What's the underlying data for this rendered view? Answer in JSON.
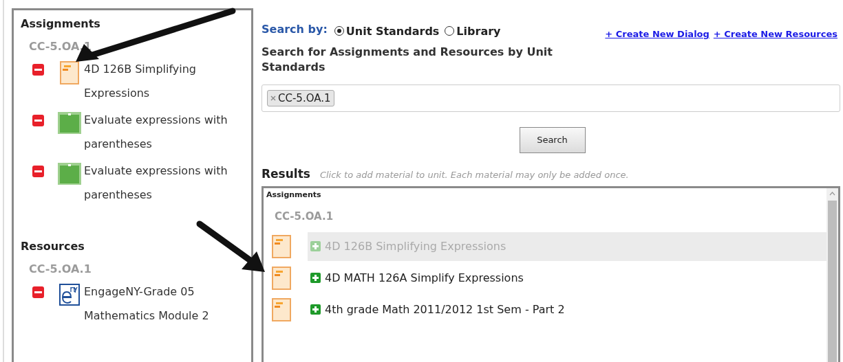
{
  "unit_panel": {
    "sections": [
      {
        "title": "Assignments",
        "standard": "CC-5.OA.1",
        "items": [
          {
            "kind": "document",
            "title": "4D 126B Simplifying Expressions"
          },
          {
            "kind": "lesson",
            "title": "Evaluate expressions with parentheses"
          },
          {
            "kind": "lesson",
            "title": "Evaluate expressions with parentheses"
          }
        ]
      },
      {
        "title": "Resources",
        "standard": "CC-5.OA.1",
        "items": [
          {
            "kind": "engageny",
            "title": "EngageNY-Grade 05 Mathematics Module 2"
          }
        ]
      }
    ]
  },
  "search_by": {
    "label": "Search by:",
    "options": [
      {
        "label": "Unit Standards",
        "selected": true
      },
      {
        "label": "Library",
        "selected": false
      }
    ]
  },
  "links": [
    "+ Create New Dialog",
    "+ Create New Resources"
  ],
  "search_heading": "Search for Assignments and Resources by Unit Standards",
  "search_field": {
    "tags": [
      "CC-5.OA.1"
    ]
  },
  "search_button": "Search",
  "results": {
    "title": "Results",
    "hint": "Click to add material to unit. Each material may only be added once.",
    "section": "Assignments",
    "standard": "CC-5.OA.1",
    "items": [
      {
        "title": "4D 126B Simplifying Expressions",
        "added": true
      },
      {
        "title": "4D MATH 126A Simplify Expressions",
        "added": false
      },
      {
        "title": "4th grade Math 2011/2012 1st Sem - Part 2",
        "added": false
      }
    ]
  }
}
